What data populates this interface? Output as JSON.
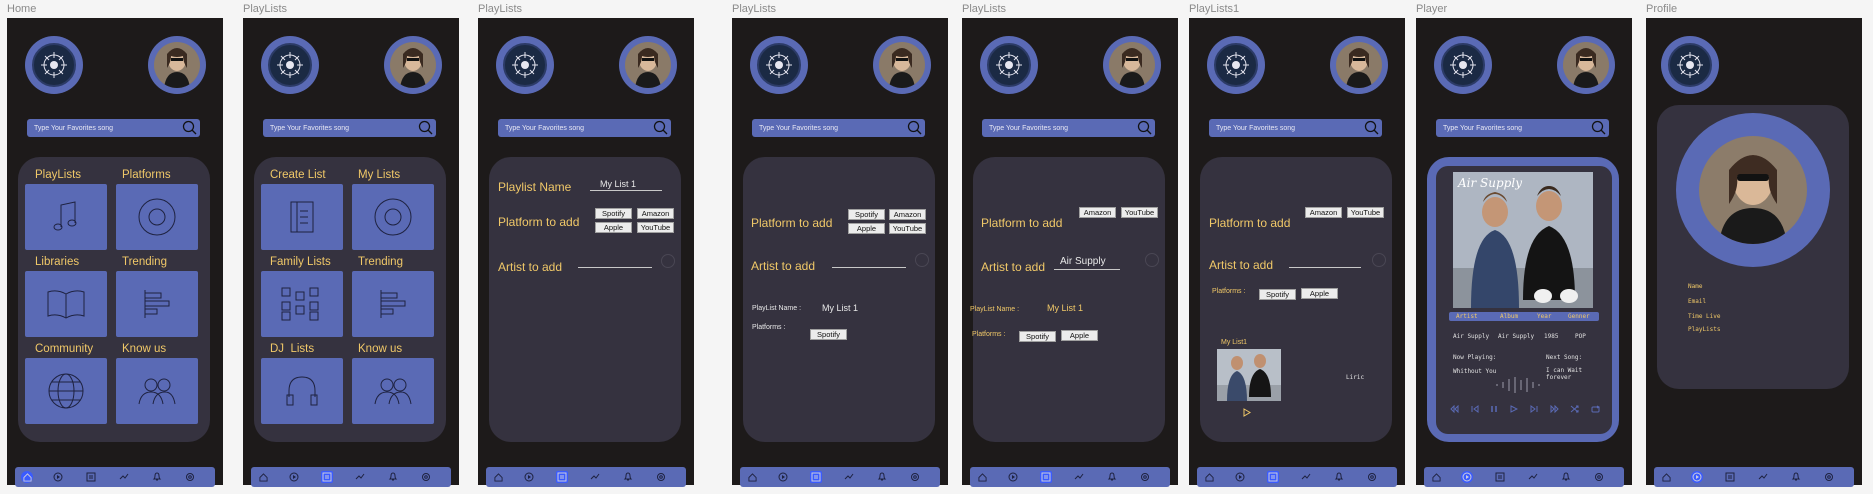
{
  "frames": [
    {
      "label": "Home"
    },
    {
      "label": "PlayLists"
    },
    {
      "label": "PlayLists"
    },
    {
      "label": "PlayLists"
    },
    {
      "label": "PlayLists"
    },
    {
      "label": "PlayLists1"
    },
    {
      "label": "Player"
    },
    {
      "label": "Profile"
    }
  ],
  "search": {
    "placeholder": "Type Your Favorites song"
  },
  "home": {
    "tiles": [
      "PlayLists",
      "Platforms",
      "Libraries",
      "Trending",
      "Community",
      "Know us"
    ]
  },
  "playlists_menu": {
    "tiles": [
      "Create List",
      "My Lists",
      "Family Lists",
      "Trending",
      "DJ  Lists",
      "Know us"
    ]
  },
  "create": {
    "playlist_name_label": "Playlist Name",
    "playlist_name_value": "My List 1",
    "platform_label": "Platform to add",
    "artist_label": "Artist to add",
    "platforms": [
      "Spotify",
      "Amazon",
      "Apple",
      "YouTube"
    ]
  },
  "summary": {
    "name_label": "PlayList Name :",
    "name_value": "My List 1",
    "platforms_label": "Platforms :",
    "artist_value": "Air Supply",
    "only_platforms": [
      "Amazon",
      "YouTube"
    ],
    "chosen_a": [
      "Spotify"
    ],
    "chosen_b": [
      "Spotify",
      "Apple"
    ]
  },
  "playlists1": {
    "list_title": "My List1",
    "liric": "Liric"
  },
  "player": {
    "cover_title": "Air Supply",
    "columns": [
      "Artist",
      "Album",
      "Year",
      "Genner"
    ],
    "values": [
      "Air Supply",
      "Air Supply",
      "1985",
      "POP"
    ],
    "now_playing_label": "Now Playing:",
    "now_playing_value": "Whithout You",
    "next_label": "Next Song:",
    "next_value": "I can Wait forever"
  },
  "profile": {
    "fields": [
      "Name",
      "Email",
      "Time Live",
      "PlayLists"
    ]
  },
  "colors": {
    "frame_bg": "#1d1a1a",
    "panel": "#35323f",
    "accent": "#5a6ab5",
    "gold": "#f0c868",
    "active": "#3a5bff"
  }
}
